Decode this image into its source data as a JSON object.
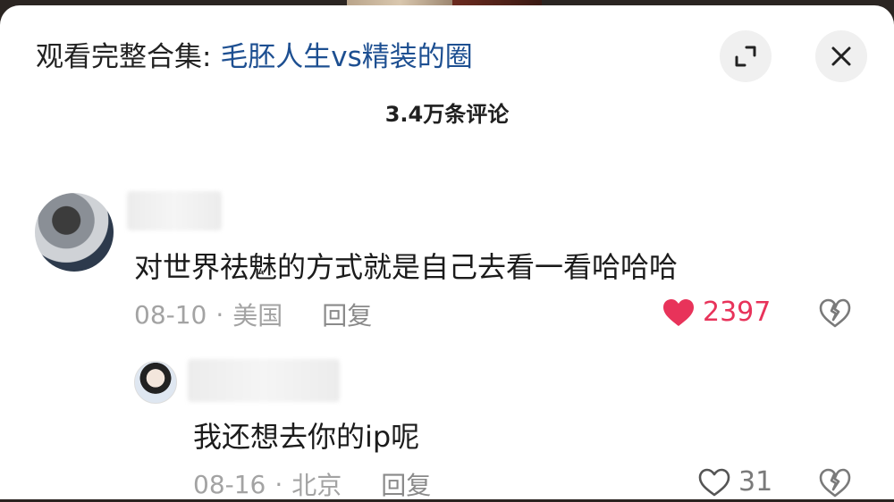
{
  "header": {
    "title_prefix": "观看完整合集: ",
    "title_link": "毛胚人生vs精装的圈",
    "expand_icon": "expand-icon",
    "close_icon": "close-icon"
  },
  "comment_count": "3.4万条评论",
  "comments": [
    {
      "text": "对世界祛魅的方式就是自己去看一看哈哈哈",
      "date": "08-10",
      "separator": "·",
      "location": "美国",
      "reply_label": "回复",
      "likes": "2397",
      "liked": true,
      "like_color": "#e8335a"
    },
    {
      "text": "我还想去你的ip呢",
      "date": "08-16",
      "separator": "·",
      "location": "北京",
      "reply_label": "回复",
      "likes": "31",
      "liked": false
    }
  ]
}
